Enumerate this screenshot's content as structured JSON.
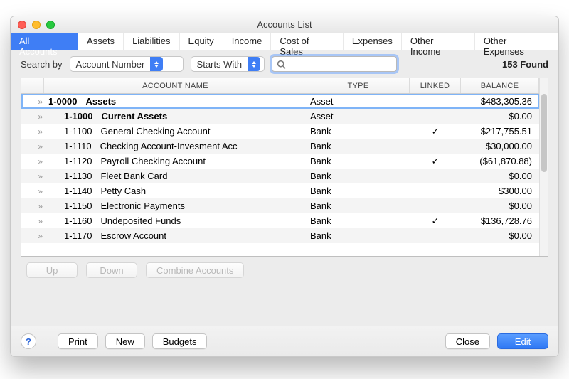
{
  "window": {
    "title": "Accounts List"
  },
  "tabs": [
    {
      "label": "All Accounts",
      "active": true
    },
    {
      "label": "Assets"
    },
    {
      "label": "Liabilities"
    },
    {
      "label": "Equity"
    },
    {
      "label": "Income"
    },
    {
      "label": "Cost of Sales"
    },
    {
      "label": "Expenses"
    },
    {
      "label": "Other Income"
    },
    {
      "label": "Other Expenses"
    }
  ],
  "search": {
    "label": "Search by",
    "field_select": "Account Number",
    "match_select": "Starts With",
    "query": "",
    "results_text": "153 Found"
  },
  "columns": {
    "name": "ACCOUNT NAME",
    "type": "TYPE",
    "linked": "LINKED",
    "balance": "BALANCE"
  },
  "rows": [
    {
      "indent": 0,
      "code": "1-0000",
      "name": "Assets",
      "type": "Asset",
      "linked": false,
      "balance": "$483,305.36",
      "bold": true,
      "selected": true
    },
    {
      "indent": 1,
      "code": "1-1000",
      "name": "Current Assets",
      "type": "Asset",
      "linked": false,
      "balance": "$0.00",
      "bold": true
    },
    {
      "indent": 1,
      "code": "1-1100",
      "name": "General Checking Account",
      "type": "Bank",
      "linked": true,
      "balance": "$217,755.51"
    },
    {
      "indent": 1,
      "code": "1-1110",
      "name": "Checking Account-Invesment Acc",
      "type": "Bank",
      "linked": false,
      "balance": "$30,000.00"
    },
    {
      "indent": 1,
      "code": "1-1120",
      "name": "Payroll Checking Account",
      "type": "Bank",
      "linked": true,
      "balance": "($61,870.88)"
    },
    {
      "indent": 1,
      "code": "1-1130",
      "name": "Fleet Bank Card",
      "type": "Bank",
      "linked": false,
      "balance": "$0.00"
    },
    {
      "indent": 1,
      "code": "1-1140",
      "name": "Petty Cash",
      "type": "Bank",
      "linked": false,
      "balance": "$300.00"
    },
    {
      "indent": 1,
      "code": "1-1150",
      "name": "Electronic Payments",
      "type": "Bank",
      "linked": false,
      "balance": "$0.00"
    },
    {
      "indent": 1,
      "code": "1-1160",
      "name": "Undeposited Funds",
      "type": "Bank",
      "linked": true,
      "balance": "$136,728.76"
    },
    {
      "indent": 1,
      "code": "1-1170",
      "name": "Escrow Account",
      "type": "Bank",
      "linked": false,
      "balance": "$0.00"
    }
  ],
  "mid_buttons": {
    "up": "Up",
    "down": "Down",
    "combine": "Combine Accounts"
  },
  "bottom": {
    "help": "?",
    "print": "Print",
    "new": "New",
    "budgets": "Budgets",
    "close": "Close",
    "edit": "Edit"
  }
}
